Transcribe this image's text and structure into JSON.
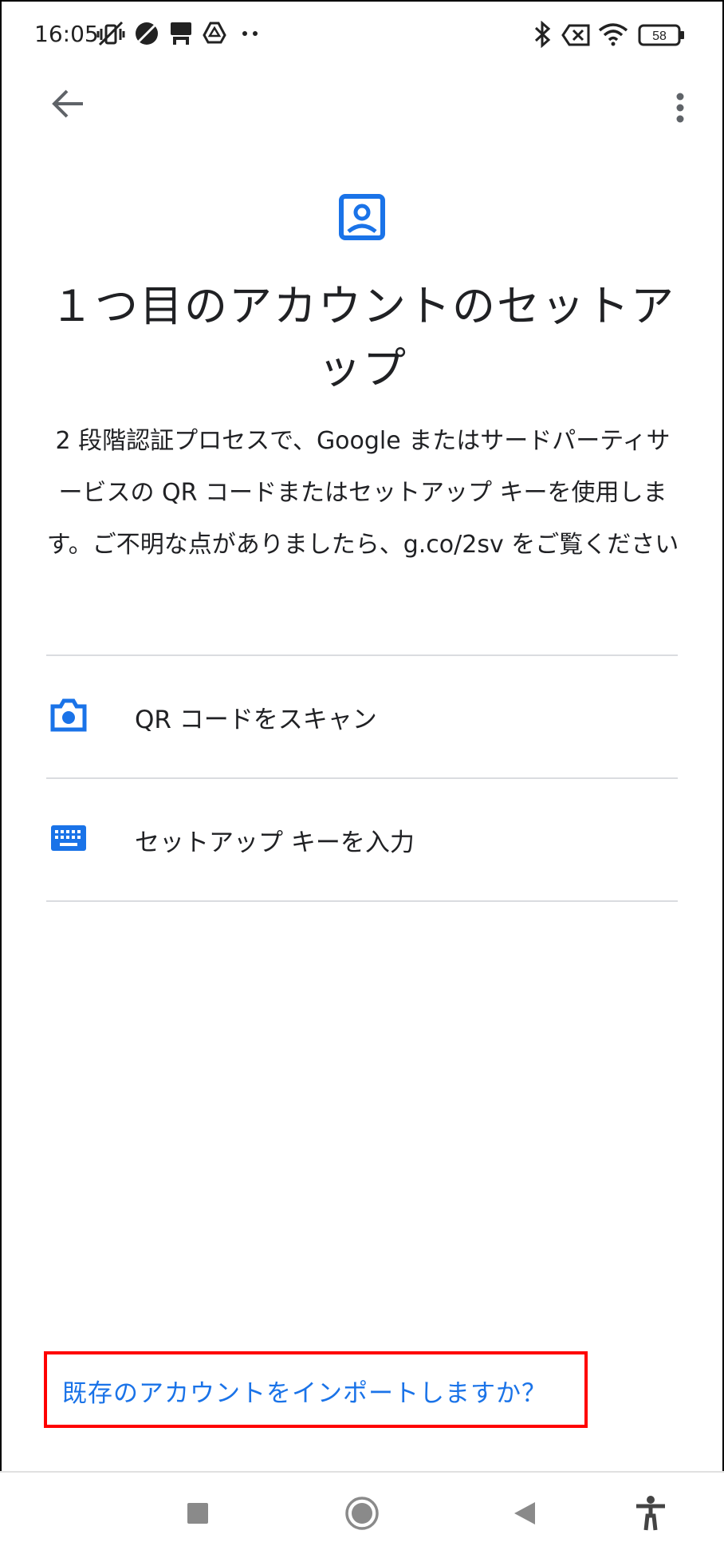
{
  "status_bar": {
    "time": "16:05",
    "battery": "58",
    "icons": [
      "vibrate-off-icon",
      "data-saver-icon",
      "desk-icon",
      "drive-icon",
      "more-dots-icon",
      "bluetooth-icon",
      "no-sim-icon",
      "wifi-icon",
      "battery-icon"
    ]
  },
  "app_bar": {
    "back_icon": "arrow-back-icon",
    "more_icon": "more-vert-icon"
  },
  "header": {
    "icon": "account-box-icon",
    "title": "１つ目のアカウントのセットアップ",
    "description": "2 段階認証プロセスで、Google またはサードパーティサービスの QR コードまたはセットアップ キーを使用します。ご不明な点がありましたら、g.co/2sv をご覧ください"
  },
  "options": [
    {
      "icon": "camera-icon",
      "label": "QR コードをスキャン"
    },
    {
      "icon": "keyboard-icon",
      "label": "セットアップ キーを入力"
    }
  ],
  "import_link": "既存のアカウントをインポートしますか？",
  "nav_bar": {
    "items": [
      "recents-icon",
      "home-icon",
      "back-icon",
      "accessibility-icon"
    ]
  },
  "colors": {
    "accent": "#1a73e8",
    "highlight_border": "#ff0000",
    "divider": "#dadce0"
  }
}
